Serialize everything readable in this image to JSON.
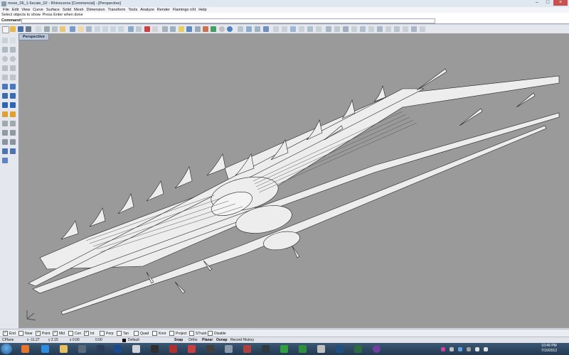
{
  "window": {
    "title": "move_06_1-6scale_02 - Rhinoceros [Commercial] - [Perspective]"
  },
  "menu": [
    "File",
    "Edit",
    "View",
    "Curve",
    "Surface",
    "Solid",
    "Mesh",
    "Dimension",
    "Transform",
    "Tools",
    "Analyze",
    "Render",
    "Flamingo nXt",
    "Help"
  ],
  "command": {
    "history": "Select objects to show. Press Enter when done",
    "label": "Command:",
    "value": ""
  },
  "viewport": {
    "tab": "Perspective"
  },
  "osnap": [
    {
      "label": "End",
      "checked": true
    },
    {
      "label": "Near",
      "checked": false
    },
    {
      "label": "Point",
      "checked": true
    },
    {
      "label": "Mid",
      "checked": true
    },
    {
      "label": "Cen",
      "checked": false
    },
    {
      "label": "Int",
      "checked": true
    },
    {
      "label": "Perp",
      "checked": false
    },
    {
      "label": "Tan",
      "checked": false
    },
    {
      "label": "Quad",
      "checked": false
    },
    {
      "label": "Knot",
      "checked": false
    },
    {
      "label": "Project",
      "checked": false
    },
    {
      "label": "STrack",
      "checked": false
    },
    {
      "label": "Disable",
      "checked": false
    }
  ],
  "status": {
    "cplane": "CPlane",
    "x": "x -11.27",
    "y": "y 2.15",
    "z": "z 0.00",
    "val": "0.00",
    "layer": "Default",
    "snap": "Snap",
    "ortho": "Ortho",
    "planar": "Planar",
    "osnap": "Osnap",
    "history": "Record History"
  },
  "clock": {
    "time": "10:49 PM",
    "date": "7/10/2012"
  },
  "colors": {
    "viewport_bg": "#9a9a9a",
    "model": "#ededed",
    "edge": "#222222"
  }
}
